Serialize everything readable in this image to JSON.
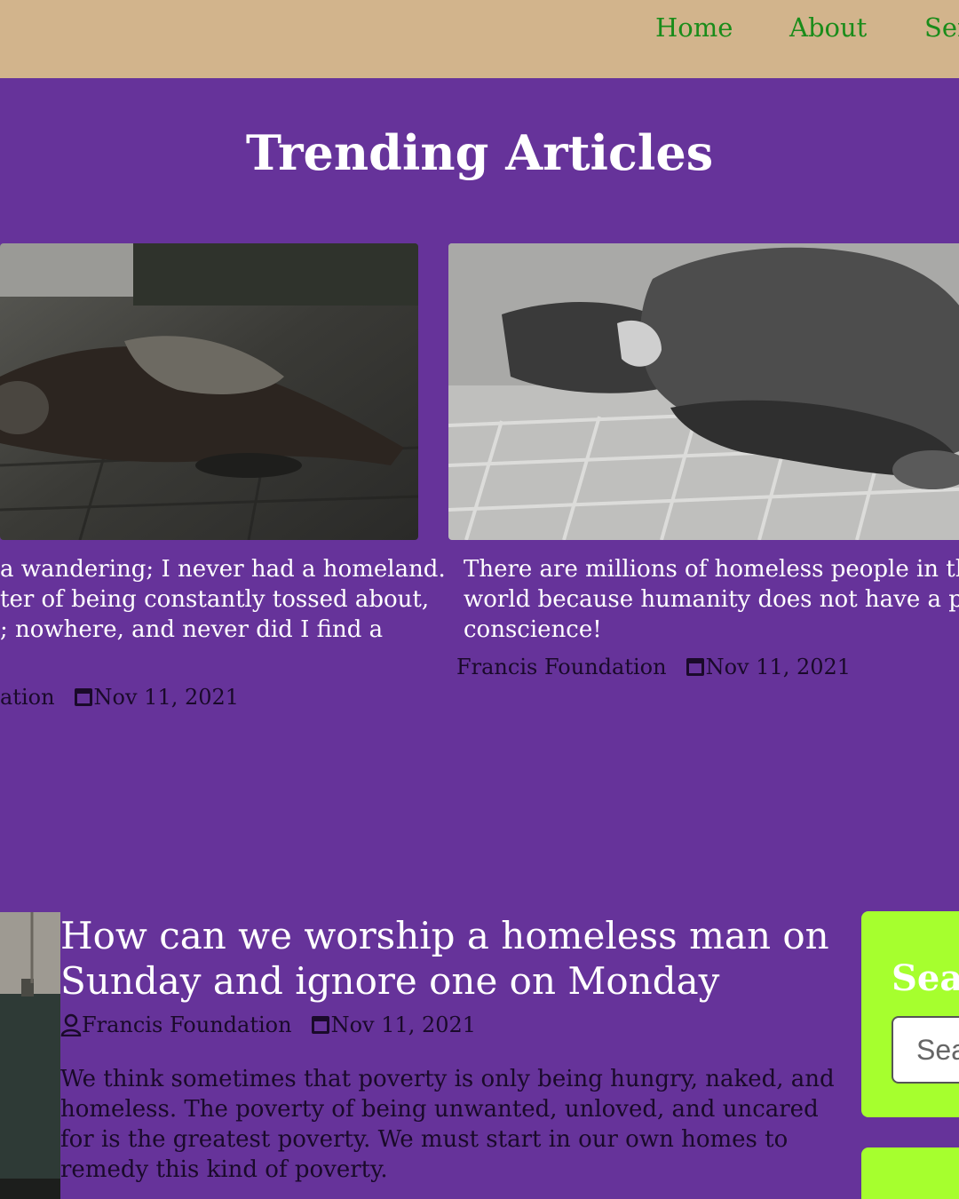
{
  "nav": {
    "home": "Home",
    "about": "About",
    "services": "Ser"
  },
  "trending": {
    "title": "Trending Articles",
    "cards": [
      {
        "lines": [
          "a wandering; I never had a homeland.",
          "ter of being constantly tossed about,",
          "; nowhere, and never did I find a"
        ],
        "author": "ation",
        "date": "Nov 11, 2021"
      },
      {
        "lines": [
          "There are millions of homeless people in the",
          "world because humanity does not have a prop",
          "conscience!"
        ],
        "author": "Francis Foundation",
        "date": "Nov 11, 2021"
      }
    ]
  },
  "post": {
    "title": "How can we worship a homeless man on Sunday and ignore one on Monday",
    "author": "Francis Foundation",
    "date": "Nov 11, 2021",
    "excerpt": "We think sometimes that poverty is only being hungry, naked, and homeless. The poverty of being unwanted, unloved, and uncared for is the greatest poverty. We must start in our own homes to remedy this kind of poverty."
  },
  "sidebar": {
    "search_title": "Sear",
    "search_placeholder": "Sea"
  },
  "colors": {
    "background": "#66339a",
    "nav_bar": "#d2b48c",
    "nav_link": "#1a8c1a",
    "widget": "#a6ff2e"
  }
}
